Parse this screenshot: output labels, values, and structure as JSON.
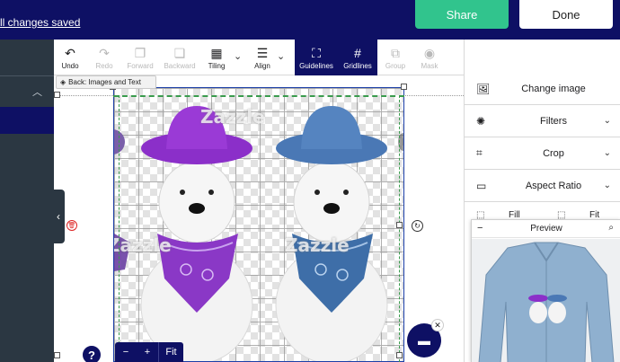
{
  "header": {
    "save_status": "ll changes saved",
    "share_label": "Share",
    "done_label": "Done"
  },
  "toolbar": {
    "undo": "Undo",
    "redo": "Redo",
    "forward": "Forward",
    "backward": "Backward",
    "tiling": "Tiling",
    "align": "Align",
    "guidelines": "Guidelines",
    "gridlines": "Gridlines",
    "group": "Group",
    "mask": "Mask"
  },
  "canvas": {
    "back_label": "Back: Images and Text",
    "watermark": "Zazzle"
  },
  "zoom": {
    "minus": "−",
    "plus": "+",
    "fit": "Fit"
  },
  "help": {
    "label": "?"
  },
  "right_panel": {
    "change_image": "Change image",
    "filters": "Filters",
    "crop": "Crop",
    "aspect_ratio": "Aspect Ratio",
    "fill_1": "Fill",
    "fill_2": "Fit"
  },
  "preview": {
    "title": "Preview",
    "minus": "−"
  },
  "colors": {
    "navy": "#0e1064",
    "share_green": "#31c48d",
    "hat_purple": "#8b2fc9",
    "hat_blue": "#4a78b5"
  }
}
